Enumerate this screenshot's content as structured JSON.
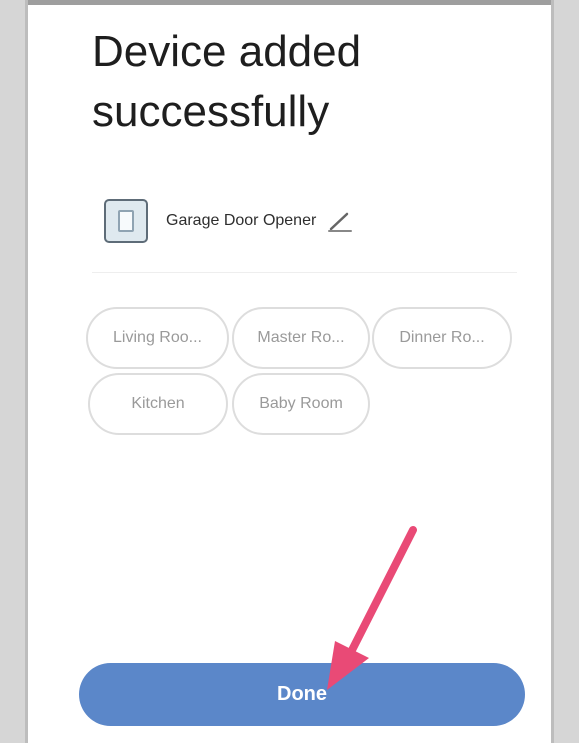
{
  "page": {
    "title": "Device added successfully"
  },
  "device": {
    "name": "Garage Door Opener",
    "icon": "garage-door-device-icon",
    "edit_icon": "pencil-icon"
  },
  "rooms": [
    {
      "label": "Living Roo..."
    },
    {
      "label": "Master Ro..."
    },
    {
      "label": "Dinner Ro..."
    },
    {
      "label": "Kitchen"
    },
    {
      "label": "Baby Room"
    }
  ],
  "actions": {
    "done_label": "Done"
  },
  "annotation": {
    "arrow_color": "#e94a76",
    "points_to": "done-button"
  },
  "colors": {
    "primary": "#5b87c9",
    "chip_border": "#dddddd",
    "chip_text": "#9a9a9a",
    "title_text": "#1e1e1e"
  }
}
